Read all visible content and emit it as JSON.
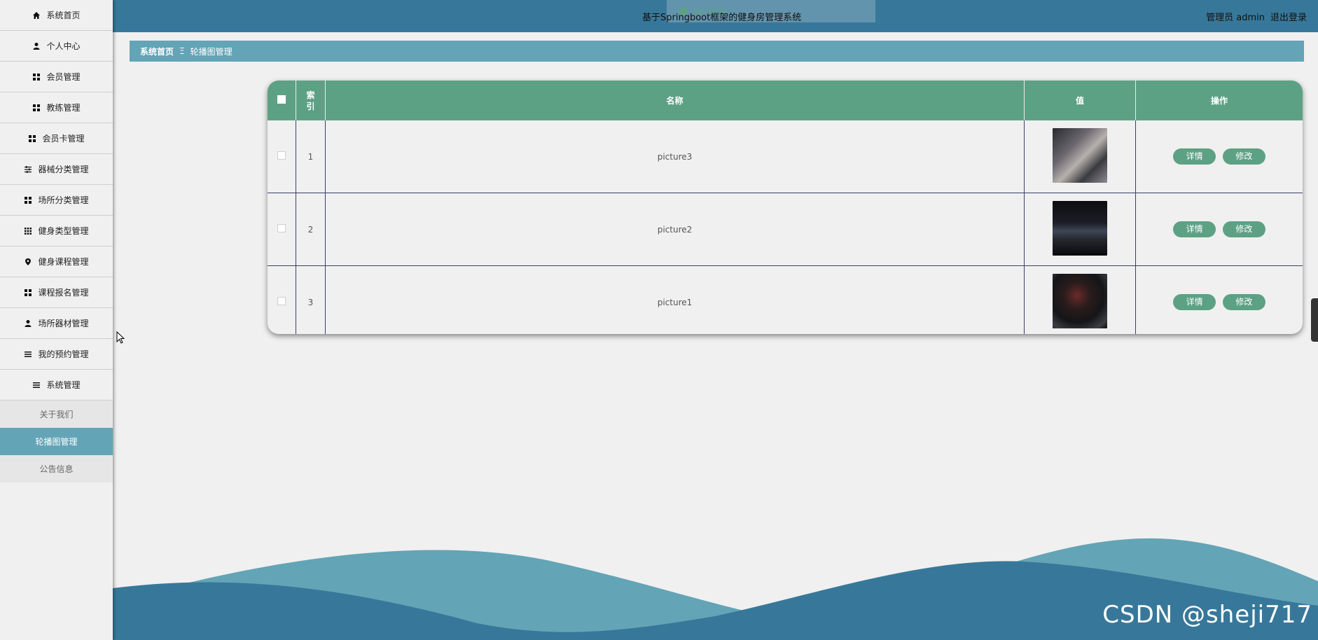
{
  "header": {
    "title": "基于Springboot框架的健身房管理系统",
    "user_label": "管理员 admin",
    "logout": "退出登录"
  },
  "toast": {
    "message": "操作成功"
  },
  "sidebar": {
    "items": [
      {
        "label": "系统首页",
        "icon": "home-icon"
      },
      {
        "label": "个人中心",
        "icon": "user-icon"
      },
      {
        "label": "会员管理",
        "icon": "grid-icon"
      },
      {
        "label": "教练管理",
        "icon": "grid-icon"
      },
      {
        "label": "会员卡管理",
        "icon": "grid-icon"
      },
      {
        "label": "器械分类管理",
        "icon": "sliders-icon"
      },
      {
        "label": "场所分类管理",
        "icon": "grid-icon"
      },
      {
        "label": "健身类型管理",
        "icon": "apps-icon"
      },
      {
        "label": "健身课程管理",
        "icon": "location-icon"
      },
      {
        "label": "课程报名管理",
        "icon": "grid-icon"
      },
      {
        "label": "场所器材管理",
        "icon": "user-icon"
      },
      {
        "label": "我的预约管理",
        "icon": "list-icon"
      },
      {
        "label": "系统管理",
        "icon": "list-icon"
      }
    ],
    "sub_items": [
      {
        "label": "关于我们",
        "active": false
      },
      {
        "label": "轮播图管理",
        "active": true
      },
      {
        "label": "公告信息",
        "active": false
      }
    ]
  },
  "breadcrumb": {
    "home": "系统首页",
    "separator": "Ξ",
    "current": "轮播图管理"
  },
  "table": {
    "headers": [
      "索引",
      "名称",
      "值",
      "操作"
    ],
    "rows": [
      {
        "index": "1",
        "name": "picture3"
      },
      {
        "index": "2",
        "name": "picture2"
      },
      {
        "index": "3",
        "name": "picture1"
      }
    ],
    "detail_label": "详情",
    "edit_label": "修改"
  },
  "watermark": "CSDN @sheji717",
  "colors": {
    "header": "#37789a",
    "accent": "#5da185",
    "breadcrumb": "#63a4b6",
    "active_sub": "#63a4b6"
  }
}
